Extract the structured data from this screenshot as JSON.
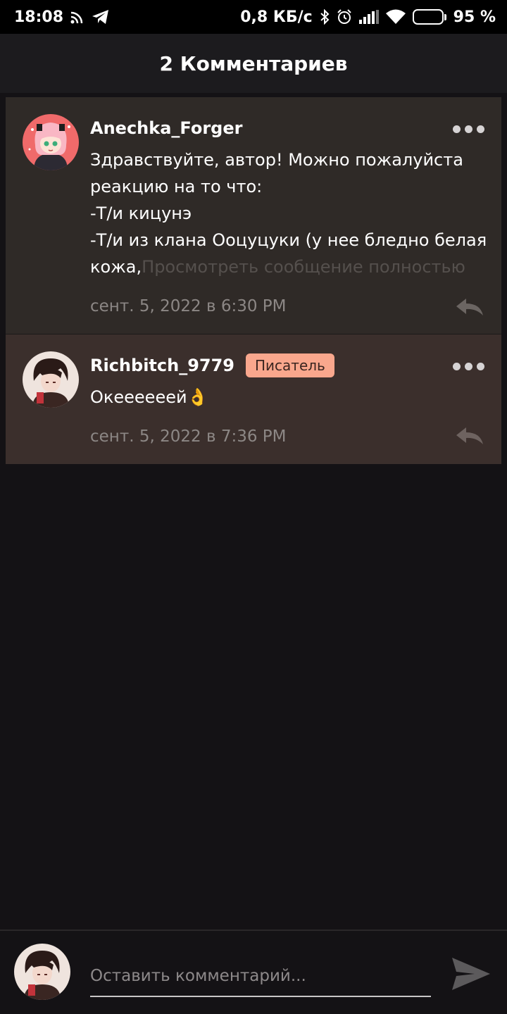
{
  "status_bar": {
    "time": "18:08",
    "net_speed": "0,8 КБ/с",
    "battery_percent": "95 %",
    "battery_level": 0.95,
    "battery_color": "#f5a31a"
  },
  "header": {
    "title": "2 Комментариев"
  },
  "comments": [
    {
      "username": "Anechka_Forger",
      "avatar": "pink-hair-anime-girl-avatar",
      "lines": [
        "Здравствуйте, автор! Можно пожалуйста реакцию на то что:",
        "-Т/и кицунэ",
        "-Т/и из клана Ооцуцуки (у нее бледно белая кожа,"
      ],
      "view_more": "Просмотреть сообщение полностью",
      "timestamp": "сент. 5, 2022 в 6:30 PM"
    },
    {
      "username": "Richbitch_9779",
      "badge": "Писатель",
      "avatar": "dark-hair-anime-boy-avatar",
      "text": "Океееееей👌",
      "timestamp": "сент. 5, 2022 в 7:36 PM"
    }
  ],
  "composer": {
    "placeholder": "Оставить комментарий...",
    "avatar": "dark-hair-anime-boy-avatar"
  },
  "colors": {
    "background": "#141215",
    "comment_bg": "#2f2a27",
    "author_comment_bg": "#3b2f2c",
    "badge_bg": "#f9a78d"
  }
}
